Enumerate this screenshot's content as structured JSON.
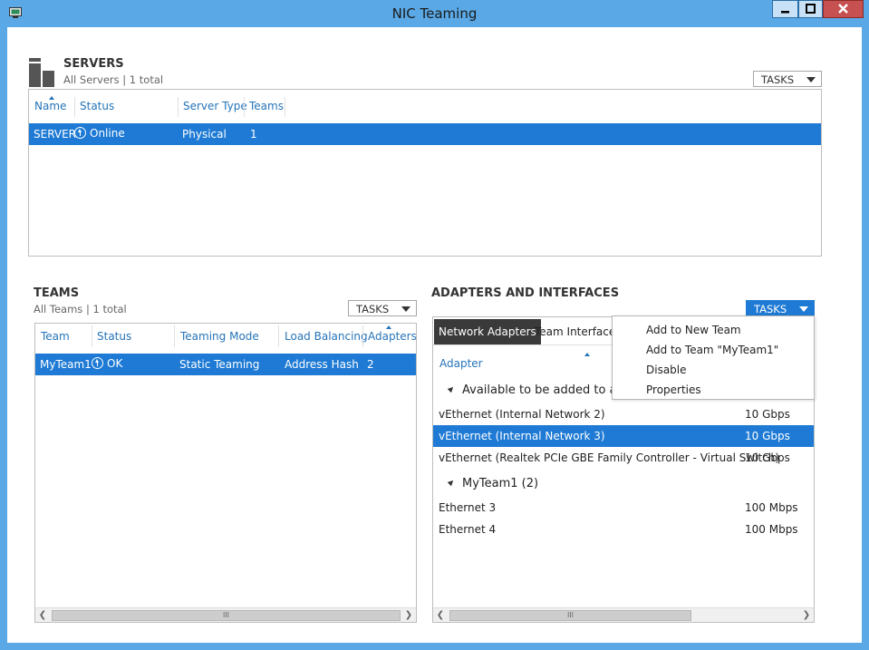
{
  "window": {
    "title": "NIC Teaming"
  },
  "servers": {
    "title": "SERVERS",
    "subtitle": "All Servers | 1 total",
    "tasks_label": "TASKS",
    "columns": [
      "Name",
      "Status",
      "Server Type",
      "Teams"
    ],
    "rows": [
      {
        "name": "SERVER",
        "status": "Online",
        "type": "Physical",
        "teams": "1"
      }
    ]
  },
  "teams": {
    "title": "TEAMS",
    "subtitle": "All Teams | 1 total",
    "tasks_label": "TASKS",
    "columns": [
      "Team",
      "Status",
      "Teaming Mode",
      "Load Balancing",
      "Adapters"
    ],
    "rows": [
      {
        "team": "MyTeam1",
        "status": "OK",
        "mode": "Static Teaming",
        "lb": "Address Hash",
        "adapters": "2"
      }
    ],
    "scroll_grip": "III"
  },
  "adapters": {
    "title": "ADAPTERS AND INTERFACES",
    "tasks_label": "TASKS",
    "tabs": [
      "Network Adapters",
      "Team Interfaces"
    ],
    "column": "Adapter",
    "groups": [
      {
        "label": "Available to be added to a",
        "items": [
          {
            "name": "vEthernet (Internal Network 2)",
            "speed": "10 Gbps"
          },
          {
            "name": "vEthernet (Internal Network 3)",
            "speed": "10 Gbps"
          },
          {
            "name": "vEthernet (Realtek PCIe GBE Family Controller - Virtual Switch)",
            "speed": "10 Gbps"
          }
        ]
      },
      {
        "label": "MyTeam1 (2)",
        "items": [
          {
            "name": "Ethernet 3",
            "speed": "100 Mbps"
          },
          {
            "name": "Ethernet 4",
            "speed": "100 Mbps"
          }
        ]
      }
    ],
    "scroll_grip": "III"
  },
  "tasks_menu": {
    "items": [
      "Add to New Team",
      "Add to Team \"MyTeam1\"",
      "Disable",
      "Properties"
    ]
  },
  "colors": {
    "selection": "#1e7ad4",
    "header_text": "#2574b8",
    "window_border": "#5aa9e6"
  },
  "icons": {
    "app": "nic-teaming-app-icon",
    "servers": "server-stack-icon",
    "status": "up-arrow-circle-icon"
  }
}
